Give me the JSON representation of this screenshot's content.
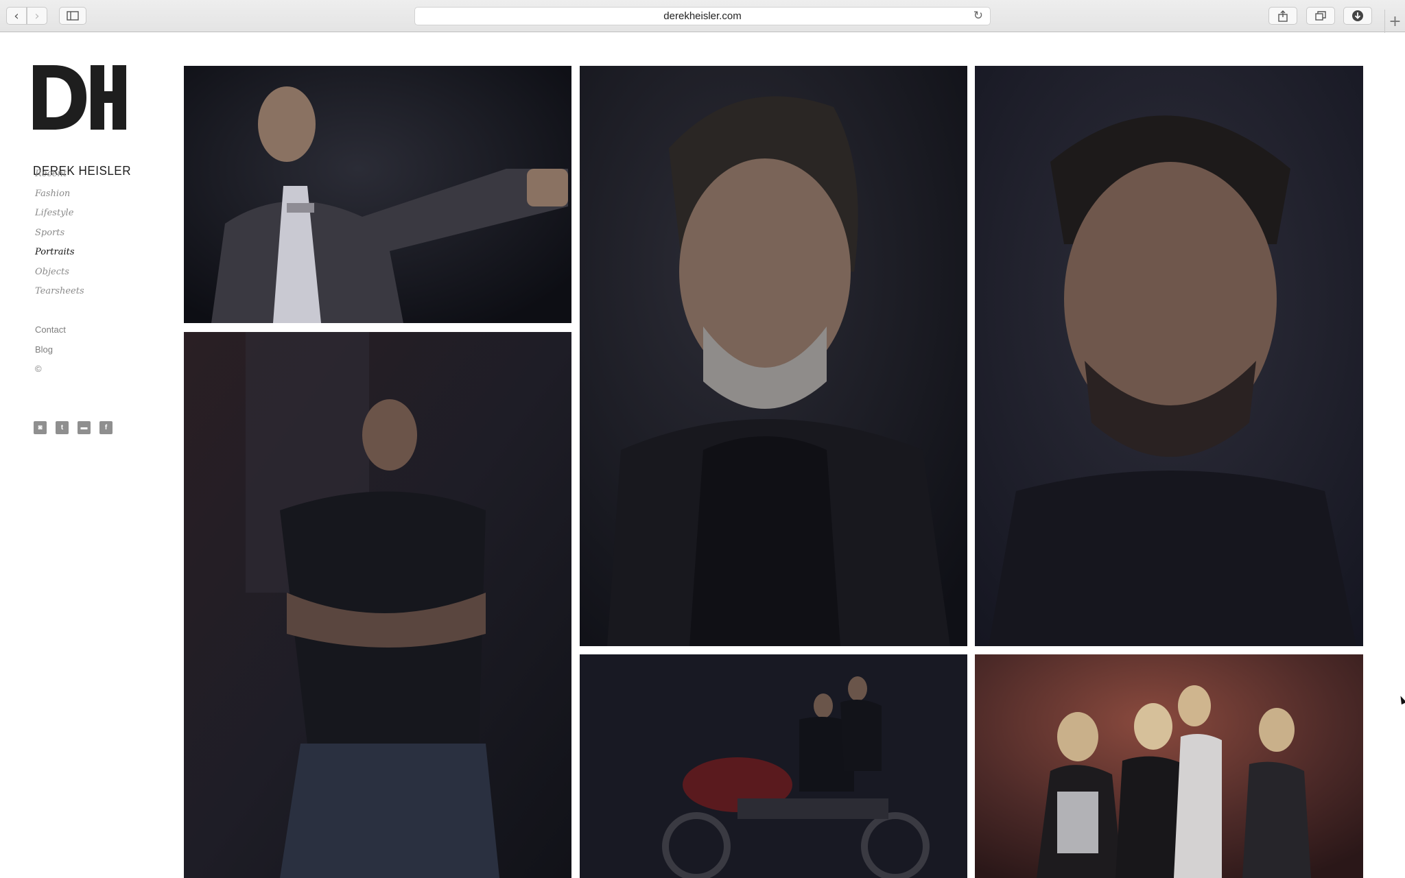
{
  "browser": {
    "url": "derekheisler.com",
    "back_icon": "‹",
    "forward_icon": "›",
    "reload_icon": "↻",
    "plus_icon": "+"
  },
  "site": {
    "logo_text": "DEREK HEISLER",
    "nav": [
      {
        "label": "Recent",
        "active": false
      },
      {
        "label": "Fashion",
        "active": false
      },
      {
        "label": "Lifestyle",
        "active": false
      },
      {
        "label": "Sports",
        "active": false
      },
      {
        "label": "Portraits",
        "active": true
      },
      {
        "label": "Objects",
        "active": false
      },
      {
        "label": "Tearsheets",
        "active": false
      }
    ],
    "secondary_nav": [
      {
        "label": "Contact"
      },
      {
        "label": "Blog"
      },
      {
        "label": "©"
      }
    ],
    "social": [
      {
        "icon": "instagram-icon",
        "glyph": "◙"
      },
      {
        "icon": "twitter-icon",
        "glyph": "t"
      },
      {
        "icon": "vimeo-icon",
        "glyph": "▬"
      },
      {
        "icon": "facebook-icon",
        "glyph": "f"
      }
    ]
  },
  "colors": {
    "nav_active": "#111111",
    "nav_inactive": "#8a8a8a",
    "photo_dark": "#1a1b24"
  }
}
